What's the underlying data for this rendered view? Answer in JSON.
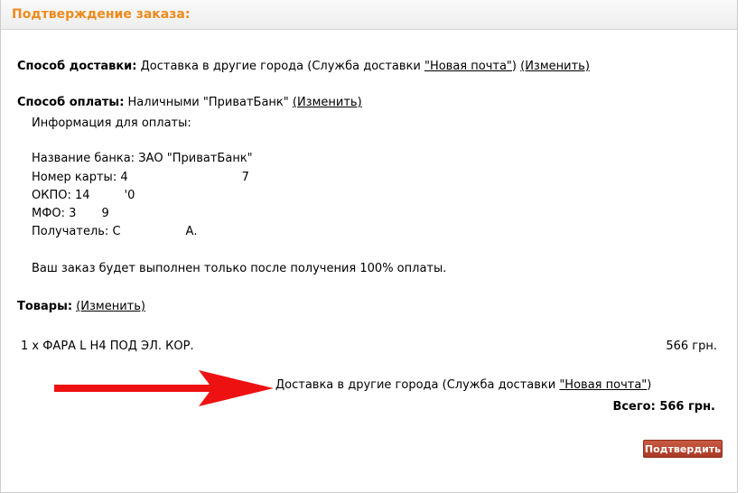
{
  "header": {
    "title": "Подтверждение заказа:"
  },
  "shipping": {
    "label": "Способ доставки:",
    "value": "Доставка в другие города (Служба доставки ",
    "carrier_link": "\"Новая почта\"",
    "after": ")",
    "change_link": "(Изменить)"
  },
  "payment": {
    "label": "Способ оплаты:",
    "value": "Наличными \"ПриватБанк\"",
    "change_link": "(Изменить)",
    "info_title": "Информация для оплаты:",
    "bank_label": "Название банка:",
    "bank_value": "ЗАО \"ПриватБанк\"",
    "card_label": "Номер карты:",
    "card_start": "4",
    "card_end": "7",
    "okpo_label": "ОКПО:",
    "okpo_start": "14",
    "okpo_end": "'0",
    "mfo_label": "МФО:",
    "mfo_start": "3",
    "mfo_end": "9",
    "recipient_label": "Получатель:",
    "recipient_start": "С",
    "recipient_end": "А.",
    "note": "Ваш заказ будет выполнен только после получения 100% оплаты."
  },
  "goods": {
    "label": "Товары:",
    "change_link": "(Изменить)",
    "items": [
      {
        "qty_name": "1 x ФАРА L H4 ПОД ЭЛ. КОР.",
        "price": "566 грн."
      }
    ],
    "delivery_text": "Доставка в другие города (Служба доставки ",
    "delivery_link": "\"Новая почта\"",
    "delivery_after": ")",
    "total": "Всего: 566 грн."
  },
  "confirm_button": "Подтвердить",
  "colors": {
    "title": "#ee8a1a",
    "button": "#b5402b",
    "arrow": "#ee1111"
  }
}
